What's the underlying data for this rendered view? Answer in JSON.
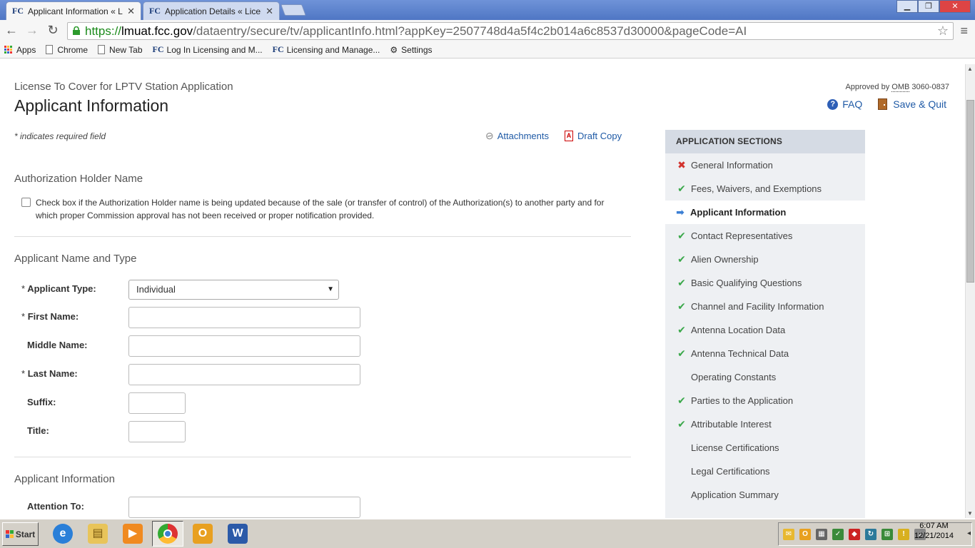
{
  "browser": {
    "tabs": [
      {
        "favicon": "FC",
        "title": "Applicant Information « Licer",
        "active": true
      },
      {
        "favicon": "FC",
        "title": "Application Details « Licensin",
        "active": false
      }
    ],
    "url_scheme": "https://",
    "url_host": "lmuat.fcc.gov",
    "url_path": "/dataentry/secure/tv/applicantInfo.html?appKey=2507748d4a5f4c2b014a6c8537d30000&pageCode=AI",
    "bookmarks": [
      {
        "icon": "apps-grid-icon",
        "label": "Apps"
      },
      {
        "icon": "page-icon",
        "label": "Chrome"
      },
      {
        "icon": "page-icon",
        "label": "New Tab"
      },
      {
        "icon": "fcc-icon",
        "label": "Log In Licensing and M..."
      },
      {
        "icon": "fcc-icon",
        "label": "Licensing and Manage..."
      },
      {
        "icon": "gear-icon",
        "label": "Settings"
      }
    ]
  },
  "header": {
    "supertitle": "License To Cover for LPTV Station Application",
    "title": "Applicant Information",
    "omb_prefix": "Approved by",
    "omb_abbr": "OMB",
    "omb_number": "3060-0837",
    "faq_label": "FAQ",
    "save_quit_label": "Save & Quit"
  },
  "toolbar": {
    "required_note": "* indicates required field",
    "attachments_label": "Attachments",
    "draft_copy_label": "Draft Copy"
  },
  "sections": {
    "auth_holder": {
      "heading": "Authorization Holder Name",
      "checkbox_text": "Check box if the Authorization Holder name is being updated because of the sale (or transfer of control) of the Authorization(s) to another party and for which proper Commission approval has not been received or proper notification provided.",
      "checked": false
    },
    "name_type": {
      "heading": "Applicant Name and Type",
      "applicant_type_label": "Applicant Type:",
      "applicant_type_value": "Individual",
      "first_name_label": "First Name:",
      "middle_name_label": "Middle Name:",
      "last_name_label": "Last Name:",
      "suffix_label": "Suffix:",
      "title_label": "Title:",
      "first_name_value": "",
      "middle_name_value": "",
      "last_name_value": "",
      "suffix_value": "",
      "title_value": ""
    },
    "applicant_info": {
      "heading": "Applicant Information",
      "attention_label": "Attention To:",
      "attention_value": ""
    },
    "required_marker": "*"
  },
  "sidebar": {
    "heading": "APPLICATION SECTIONS",
    "items": [
      {
        "label": "General Information",
        "status": "error"
      },
      {
        "label": "Fees, Waivers, and Exemptions",
        "status": "complete"
      },
      {
        "label": "Applicant Information",
        "status": "current"
      },
      {
        "label": "Contact Representatives",
        "status": "complete"
      },
      {
        "label": "Alien Ownership",
        "status": "complete"
      },
      {
        "label": "Basic Qualifying Questions",
        "status": "complete"
      },
      {
        "label": "Channel and Facility Information",
        "status": "complete"
      },
      {
        "label": "Antenna Location Data",
        "status": "complete"
      },
      {
        "label": "Antenna Technical Data",
        "status": "complete"
      },
      {
        "label": "Operating Constants",
        "status": "none"
      },
      {
        "label": "Parties to the Application",
        "status": "complete"
      },
      {
        "label": "Attributable Interest",
        "status": "complete"
      },
      {
        "label": "License Certifications",
        "status": "none"
      },
      {
        "label": "Legal Certifications",
        "status": "none"
      },
      {
        "label": "Application Summary",
        "status": "none"
      }
    ]
  },
  "taskbar": {
    "start_label": "Start",
    "apps": [
      "internet-explorer-icon",
      "file-explorer-icon",
      "media-player-icon",
      "chrome-icon",
      "outlook-icon",
      "word-icon"
    ],
    "time": "6:07 AM",
    "date": "12/21/2014"
  },
  "colors": {
    "link": "#1f5aa6",
    "check": "#3aa84a",
    "cross": "#d2322d",
    "arrow": "#3b7fd4",
    "sidebar_bg": "#eef0f3",
    "sidebar_head_bg": "#d5dbe4"
  }
}
